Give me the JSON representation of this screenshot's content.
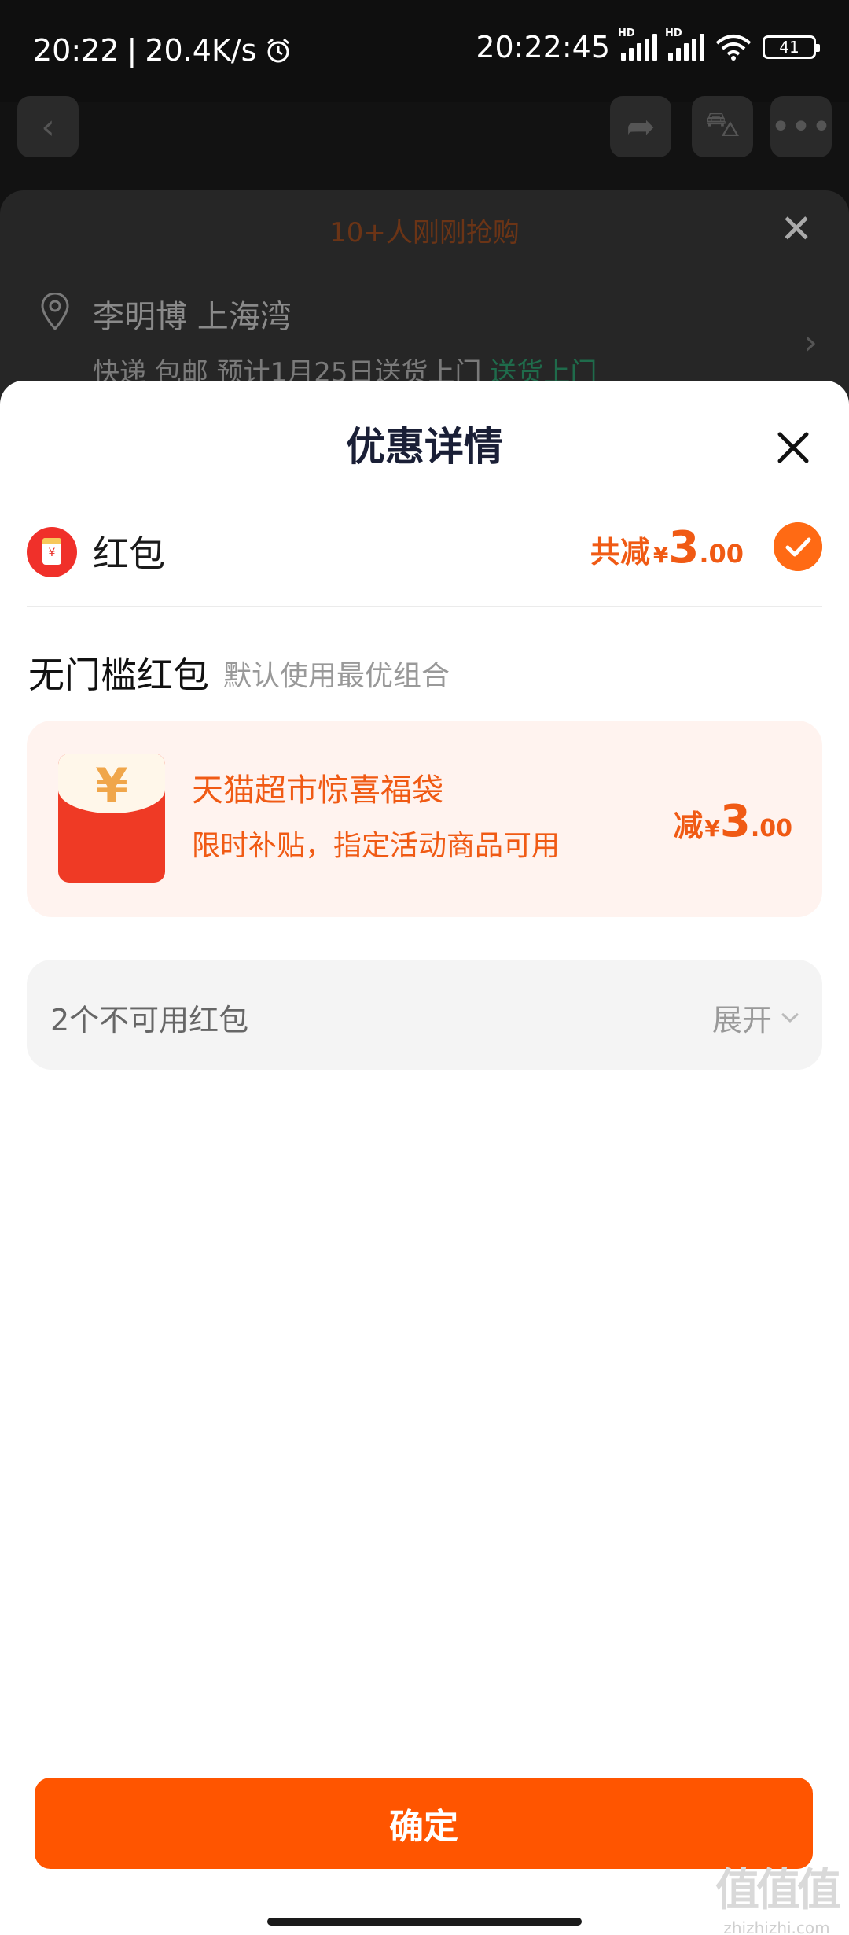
{
  "status_bar": {
    "time": "20:22",
    "net_speed": "20.4K/s",
    "clock": "20:22:45",
    "signal_label_1": "HD",
    "signal_label_2": "HD",
    "battery": "41"
  },
  "background": {
    "banner": "10+人刚刚抢购",
    "address": "李明博 上海湾",
    "delivery": "快递 包邮 预计1月25日送货上门",
    "delivery_highlight": "送货上门"
  },
  "sheet": {
    "title": "优惠详情",
    "red_packet_label": "红包",
    "total_prefix": "共减",
    "currency": "¥",
    "total_int": "3",
    "total_dec": ".00",
    "section_title": "无门槛红包",
    "section_subtitle": "默认使用最优组合",
    "coupon": {
      "icon_glyph": "¥",
      "name": "天猫超市惊喜福袋",
      "desc": "限时补贴，指定活动商品可用",
      "prefix": "减",
      "currency": "¥",
      "int": "3",
      "dec": ".00"
    },
    "unavailable_label": "2个不可用红包",
    "expand_label": "展开",
    "confirm_label": "确定"
  },
  "watermark": {
    "logo": "值值值",
    "url": "zhizhizhi.com"
  },
  "colors": {
    "accent": "#ff5500",
    "price": "#f05a14",
    "coupon_bg": "#fff3ef"
  }
}
